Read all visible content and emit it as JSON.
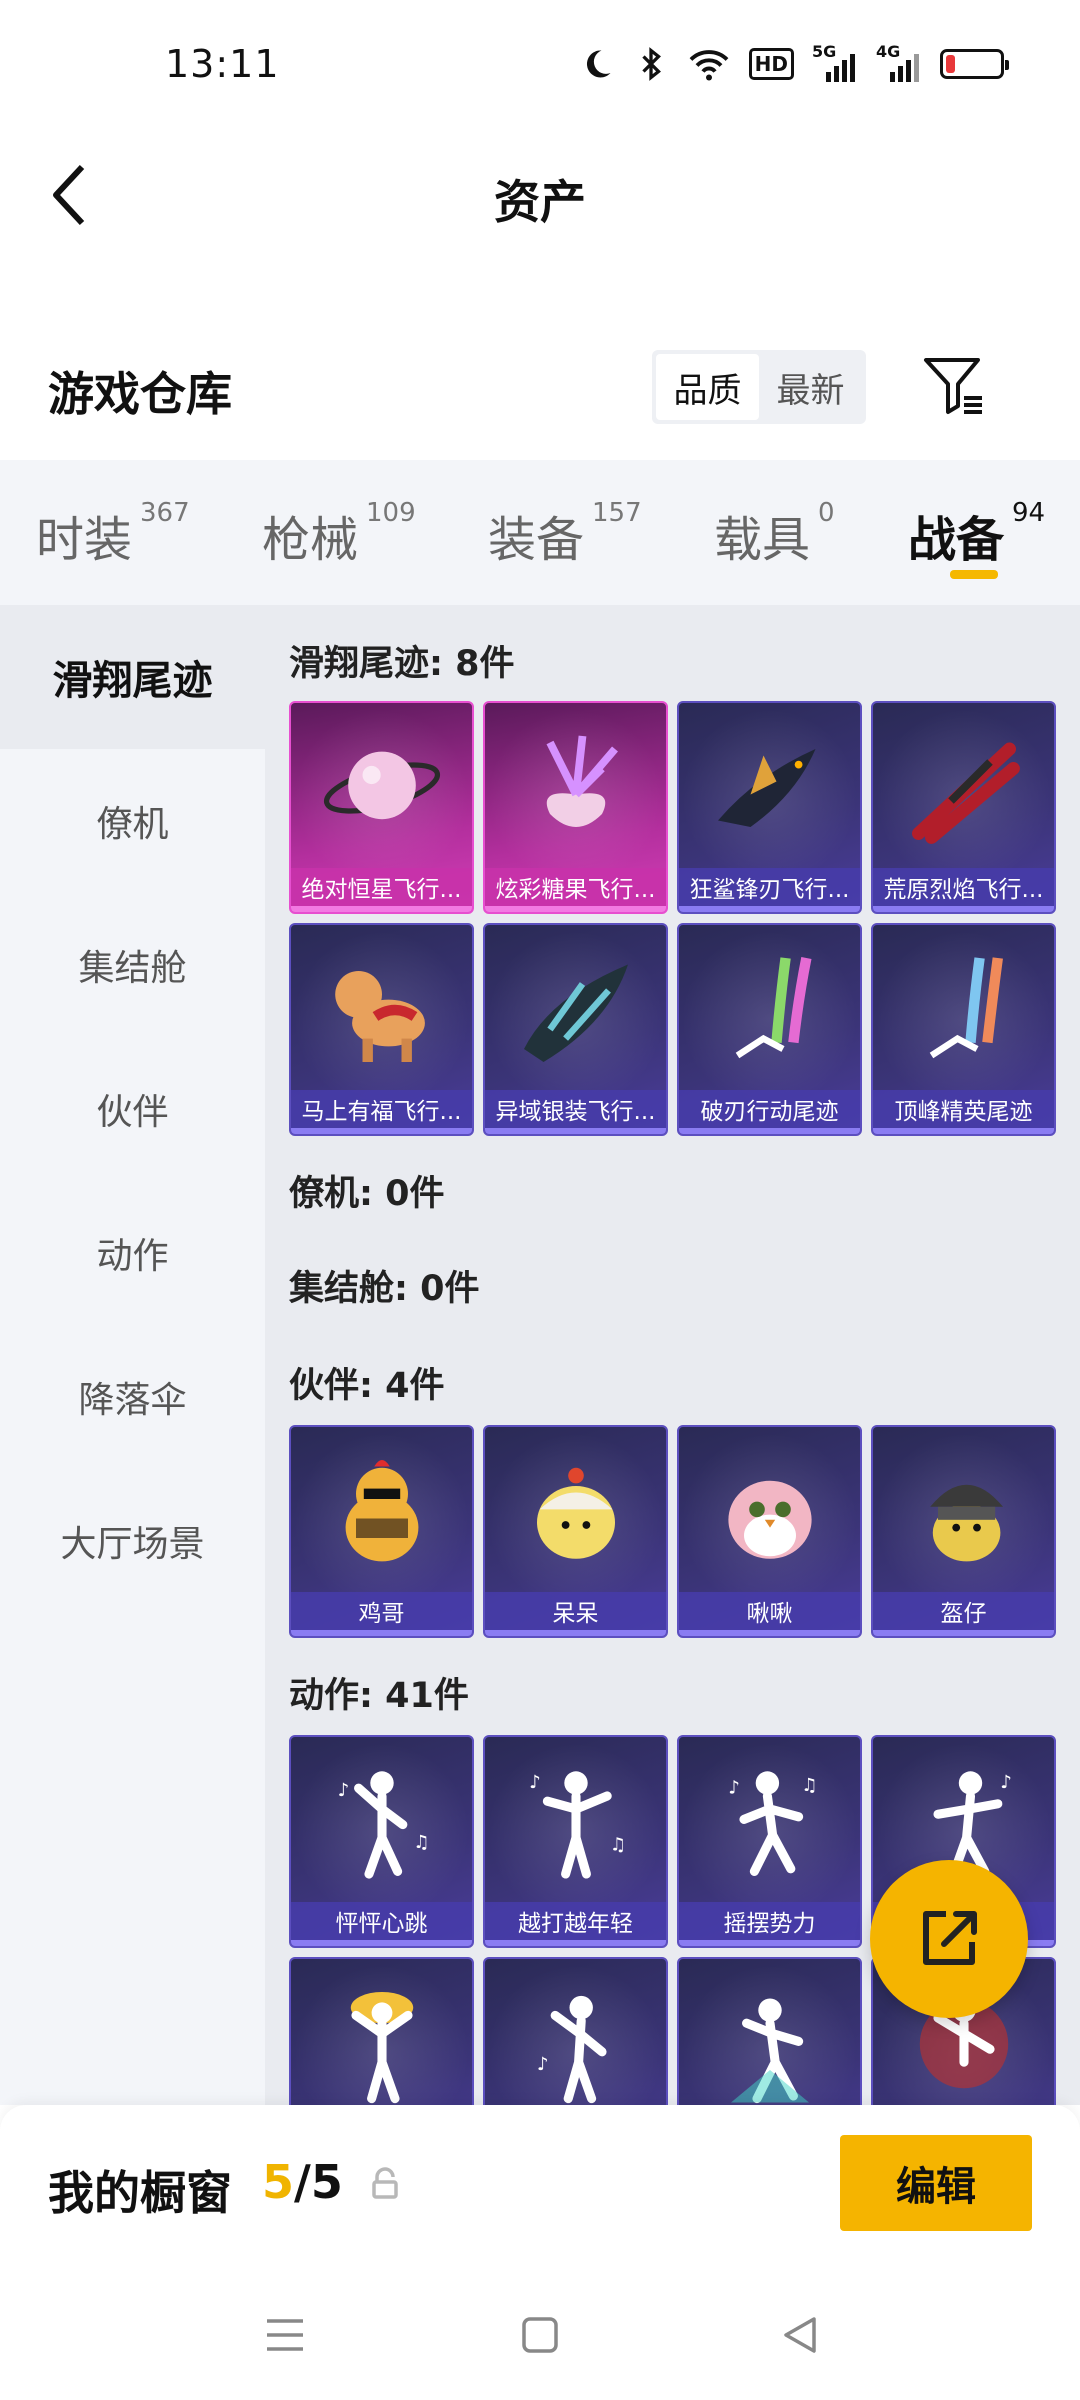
{
  "status_bar": {
    "time": "13:11",
    "hd_label": "HD",
    "sim1_label": "5G",
    "sim2_label": "4G",
    "battery_level": 0.15,
    "battery_color": "#e8383a",
    "icons": [
      "moon-icon",
      "bluetooth-icon",
      "wifi-icon",
      "hd-icon",
      "signal-icon",
      "battery-icon"
    ]
  },
  "header": {
    "title": "资产",
    "back_icon": "chevron-left-icon"
  },
  "warehouse": {
    "title": "游戏仓库",
    "sort_options": [
      "品质",
      "最新"
    ],
    "sort_selected": "品质",
    "filter_icon": "filter-icon"
  },
  "tabs": [
    {
      "label": "时装",
      "count": "367"
    },
    {
      "label": "枪械",
      "count": "109"
    },
    {
      "label": "装备",
      "count": "157"
    },
    {
      "label": "载具",
      "count": "0"
    },
    {
      "label": "战备",
      "count": "94",
      "active": true
    }
  ],
  "sidebar": {
    "items": [
      "滑翔尾迹",
      "僚机",
      "集结舱",
      "伙伴",
      "动作",
      "降落伞",
      "大厅场景"
    ],
    "active": "滑翔尾迹"
  },
  "groups": {
    "glide": {
      "title": "滑翔尾迹: 8件",
      "items": [
        {
          "label": "绝对恒星飞行...",
          "rarity": "pink"
        },
        {
          "label": "炫彩糖果飞行...",
          "rarity": "pink"
        },
        {
          "label": "狂鲨锋刃飞行...",
          "rarity": "purple"
        },
        {
          "label": "荒原烈焰飞行...",
          "rarity": "purple"
        },
        {
          "label": "马上有福飞行...",
          "rarity": "purple"
        },
        {
          "label": "异域银装飞行...",
          "rarity": "purple"
        },
        {
          "label": "破刃行动尾迹",
          "rarity": "purple"
        },
        {
          "label": "顶峰精英尾迹",
          "rarity": "purple"
        }
      ]
    },
    "wingman": {
      "title": "僚机: 0件"
    },
    "pod": {
      "title": "集结舱: 0件"
    },
    "companion": {
      "title": "伙伴: 4件",
      "items": [
        {
          "label": "鸡哥"
        },
        {
          "label": "呆呆"
        },
        {
          "label": "啾啾"
        },
        {
          "label": "盔仔"
        }
      ]
    },
    "emote": {
      "title": "动作: 41件",
      "items": [
        {
          "label": "怦怦心跳"
        },
        {
          "label": "越打越年轻"
        },
        {
          "label": "摇摆势力"
        },
        {
          "label": ""
        }
      ]
    }
  },
  "showcase": {
    "title": "我的橱窗",
    "used": "5",
    "separator": "/",
    "total": "5",
    "edit_label": "编辑",
    "accent": "#f5b400"
  },
  "share_icon": "share-external-icon",
  "nav": [
    "menu-icon",
    "home-square-icon",
    "back-triangle-icon"
  ]
}
